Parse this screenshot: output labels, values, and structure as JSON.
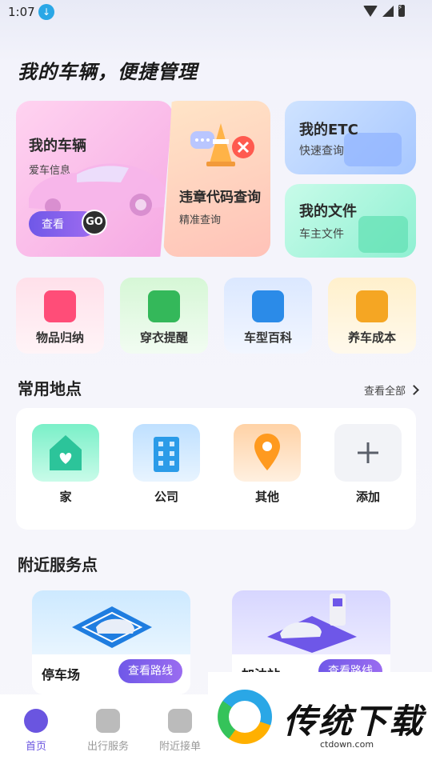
{
  "status_bar": {
    "time": "1:07"
  },
  "page_title": "我的车辆，便捷管理",
  "cards": {
    "vehicle": {
      "title": "我的车辆",
      "subtitle": "爱车信息",
      "view": "查看",
      "go": "GO"
    },
    "violation": {
      "title": "违章代码查询",
      "subtitle": "精准查询"
    },
    "etc": {
      "title": "我的ETC",
      "subtitle": "快速查询"
    },
    "files": {
      "title": "我的文件",
      "subtitle": "车主文件"
    }
  },
  "quick_items": [
    {
      "label": "物品归纳",
      "icon": "gift-box-icon",
      "color": "#ff4d78"
    },
    {
      "label": "穿衣提醒",
      "icon": "jacket-icon",
      "color": "#34b85a"
    },
    {
      "label": "车型百科",
      "icon": "car-book-icon",
      "color": "#2b8be8"
    },
    {
      "label": "养车成本",
      "icon": "money-bag-icon",
      "color": "#f5a623"
    }
  ],
  "places_section": {
    "title": "常用地点",
    "view_all": "查看全部",
    "items": [
      {
        "label": "家",
        "icon": "home-icon"
      },
      {
        "label": "公司",
        "icon": "building-icon"
      },
      {
        "label": "其他",
        "icon": "location-pin-icon"
      },
      {
        "label": "添加",
        "icon": "plus-icon"
      }
    ]
  },
  "nearby_section": {
    "title": "附近服务点",
    "items": [
      {
        "name": "停车场",
        "button": "查看路线",
        "icon": "parking-lot-icon"
      },
      {
        "name": "加油站",
        "button": "查看路线",
        "icon": "gas-station-icon"
      }
    ]
  },
  "bottom_nav": [
    {
      "label": "首页",
      "icon": "home-steering-icon",
      "active": true
    },
    {
      "label": "出行服务",
      "icon": "taxi-icon",
      "active": false
    },
    {
      "label": "附近接单",
      "icon": "taxi-order-icon",
      "active": false
    }
  ],
  "watermark": {
    "text": "传统下载",
    "url": "ctdown.com"
  }
}
